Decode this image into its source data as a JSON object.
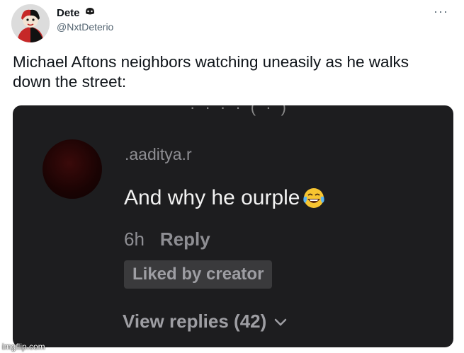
{
  "tweet": {
    "display_name": "Dete",
    "handle": "@NxtDeterio",
    "text": "Michael Aftons neighbors watching uneasily as he walks down the street:",
    "more_label": "···",
    "avatar_icon": "harley-quinn-avatar",
    "badge_icon": "mask-badge-icon"
  },
  "comment": {
    "username": ".aaditya.r",
    "text": "And why he ourple",
    "emoji_icon": "tears-of-joy-emoji",
    "time": "6h",
    "reply_label": "Reply",
    "liked_label": "Liked by creator",
    "view_replies_label": "View replies (42)",
    "chevron_icon": "chevron-down-icon"
  },
  "watermark": "imgflip.com",
  "colors": {
    "card_background": "#1d1d1f",
    "text_primary": "#0f1419",
    "text_secondary": "#536471"
  }
}
